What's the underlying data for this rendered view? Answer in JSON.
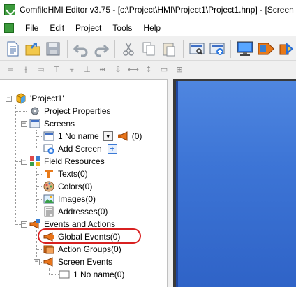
{
  "window": {
    "title": "ComfileHMI Editor v3.75 - [c:\\Project\\HMI\\Project1\\Project1.hnp] - [Screen"
  },
  "menu": {
    "file": "File",
    "edit": "Edit",
    "project": "Project",
    "tools": "Tools",
    "help": "Help"
  },
  "tree": {
    "root": "'Project1'",
    "project_properties": "Project Properties",
    "screens": "Screens",
    "screen_item": "1 No name",
    "screen_event_count": "(0)",
    "add_screen": "Add Screen",
    "field_resources": "Field Resources",
    "texts": "Texts(0)",
    "colors": "Colors(0)",
    "images": "Images(0)",
    "addresses": "Addresses(0)",
    "events_and_actions": "Events and Actions",
    "global_events": "Global Events(0)",
    "action_groups": "Action Groups(0)",
    "screen_events": "Screen Events",
    "screen_events_item": "1 No name(0)"
  },
  "colors": {
    "highlight": "#d82020",
    "canvas_screen": "#3d75d6"
  }
}
